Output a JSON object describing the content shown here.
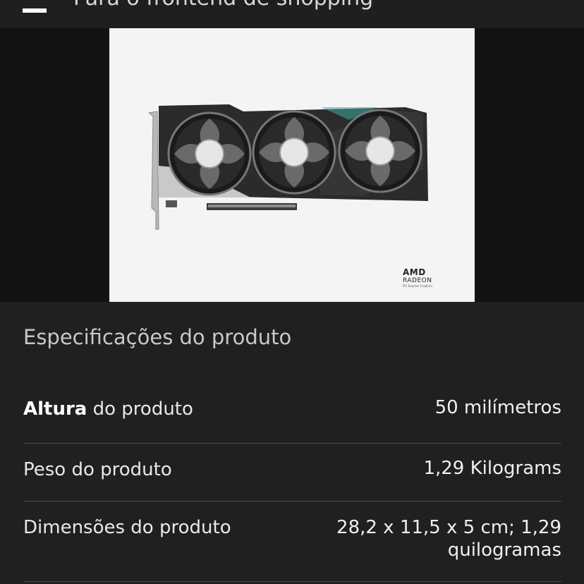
{
  "topbar": {
    "menu_icon": "hamburger-icon",
    "title": "Para o frontend de shopping"
  },
  "product_image": {
    "alt": "Placa de vídeo com três ventoinhas",
    "logo_brand": "AMD",
    "logo_product": "RADEON",
    "logo_tagline": "PCI Express Graphics"
  },
  "specs": {
    "title": "Especificações do produto",
    "rows": [
      {
        "label_bold": "Altura",
        "label_rest": " do produto",
        "value": "50 milímetros"
      },
      {
        "label": "Peso do produto",
        "value": "1,29 Kilograms"
      },
      {
        "label": "Dimensões do produto",
        "value_line1": "28,2 x 11,5 x 5 cm; 1,29",
        "value_line2": "quilogramas"
      }
    ]
  }
}
